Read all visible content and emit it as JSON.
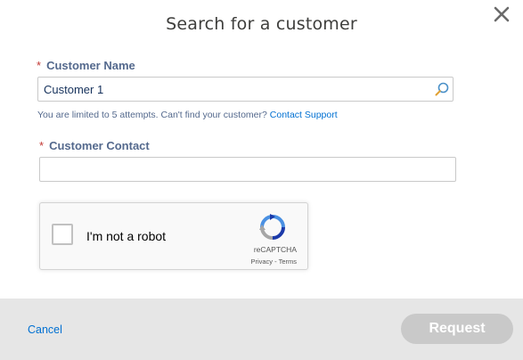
{
  "dialog": {
    "title": "Search for a customer",
    "close_icon": "close-icon"
  },
  "customer_name": {
    "required_mark": "*",
    "label": "Customer Name",
    "value": "Customer 1",
    "icon": "search-icon",
    "hint_text": "You are limited to 5 attempts. Can't find your customer?",
    "support_link": "Contact Support"
  },
  "customer_contact": {
    "required_mark": "*",
    "label": "Customer Contact",
    "value": ""
  },
  "recaptcha": {
    "checkbox_label": "I'm not a robot",
    "brand": "reCAPTCHA",
    "privacy": "Privacy",
    "separator": " - ",
    "terms": "Terms",
    "checked": false
  },
  "footer": {
    "cancel_label": "Cancel",
    "request_label": "Request",
    "request_enabled": false
  },
  "colors": {
    "link": "#0070d2",
    "required": "#c23934",
    "label": "#54698d",
    "disabled_button": "#c9c9c9",
    "footer_bg": "#e6e6e6"
  }
}
